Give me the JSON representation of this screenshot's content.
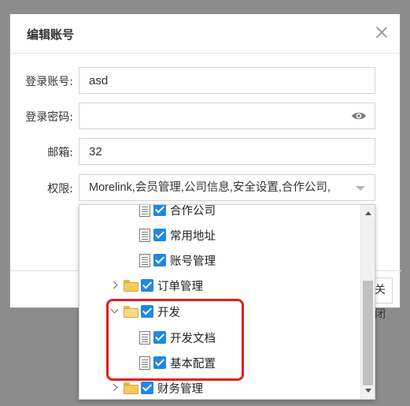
{
  "dialog": {
    "title": "编辑账号",
    "close_button": "关闭"
  },
  "form": {
    "account": {
      "label": "登录账号:",
      "value": "asd"
    },
    "password": {
      "label": "登录密码:",
      "value": ""
    },
    "email": {
      "label": "邮箱:",
      "value": "32"
    },
    "permission": {
      "label": "权限:",
      "value": "Morelink,会员管理,公司信息,安全设置,合作公司,"
    }
  },
  "tree": {
    "items": [
      {
        "label": "合作公司",
        "type": "doc",
        "checked": true,
        "partial": true
      },
      {
        "label": "常用地址",
        "type": "doc",
        "checked": true
      },
      {
        "label": "账号管理",
        "type": "doc",
        "checked": true
      },
      {
        "label": "订单管理",
        "type": "folder",
        "expanded": false,
        "checked": true
      },
      {
        "label": "开发",
        "type": "folder",
        "expanded": true,
        "checked": true
      },
      {
        "label": "开发文档",
        "type": "doc",
        "checked": true
      },
      {
        "label": "基本配置",
        "type": "doc",
        "checked": true
      },
      {
        "label": "财务管理",
        "type": "folder",
        "expanded": false,
        "checked": true
      }
    ]
  },
  "colors": {
    "checkbox": "#1e88e5",
    "highlight": "#e02020",
    "overlay": "#8c8c8c"
  },
  "icons": [
    "close-icon",
    "eye-icon",
    "chevron-down-icon",
    "document-icon",
    "folder-icon",
    "folder-open-icon",
    "checkbox-checked-icon",
    "scroll-up-icon",
    "scroll-down-icon"
  ]
}
